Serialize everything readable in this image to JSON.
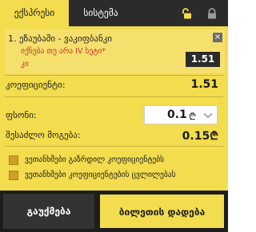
{
  "tabs": {
    "active": "ექსპრესი",
    "inactive": "სისტემა"
  },
  "icons": {
    "lock_open": "unlocked-padlock-icon",
    "lock_closed": "padlock-icon",
    "close": "close-icon",
    "chevron": "chevron-down-icon",
    "currency": "lari-icon"
  },
  "selection": {
    "number": "1.",
    "title": "ეზაუბაში - ვაკიფბანკი",
    "market": "იქნება თუ არა IV სეტი*",
    "category": "კი",
    "odds": "1.51",
    "close_label": "×"
  },
  "rows": {
    "coef_label": "კოეფიციენტი:",
    "coef_value": "1.51",
    "stake_label": "ფსონი:",
    "stake_value": "0.1",
    "currency_symbol": "₾",
    "win_label": "შესაძლო მოგება:",
    "win_value": "0.15",
    "win_currency": "₾"
  },
  "options": [
    {
      "label": "ვეთანხმები გაზრდილ კოეფიციენტებს",
      "checked": false
    },
    {
      "label": "ვეთანხმები კოეფიციენტების ცვლილებას",
      "checked": false
    }
  ],
  "buttons": {
    "cancel": "გაუქმება",
    "place": "ბილეთის დადება"
  },
  "colors": {
    "accent": "#f3dc4e",
    "dark": "#2b2b2b",
    "red_text": "#c0392b",
    "checkbox": "#c9a227"
  }
}
